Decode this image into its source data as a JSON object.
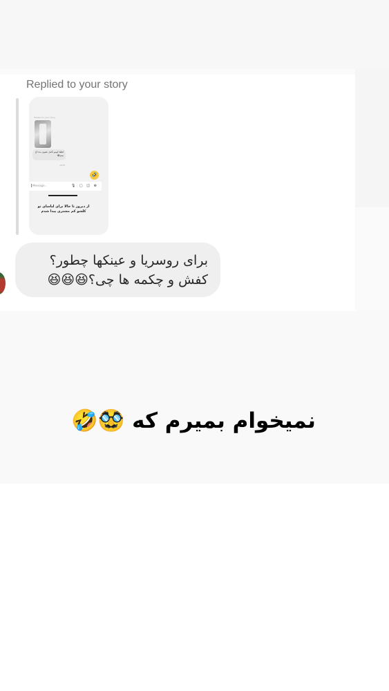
{
  "reply_label": "Replied to your story",
  "story_preview": {
    "header": "Replied to your story",
    "bubble_text": "لطفا اونیو کامل نشون بده آخ بیبم😂",
    "time": "14:11",
    "emoji": "🤣",
    "input_placeholder": "Message...",
    "input_icons": "🎙 ▢ ◫ ⊕",
    "caption": "از دیروز تا حالا برای لباسای تو کلشو کم مشتری پیدا شدم"
  },
  "message": {
    "line1": "برای روسریا و عینکها چطور؟",
    "line2": "کفش و چکمه ها چی؟😆😆😆"
  },
  "caption_text": "نمیخوام بمیرم که 🥸🤣"
}
